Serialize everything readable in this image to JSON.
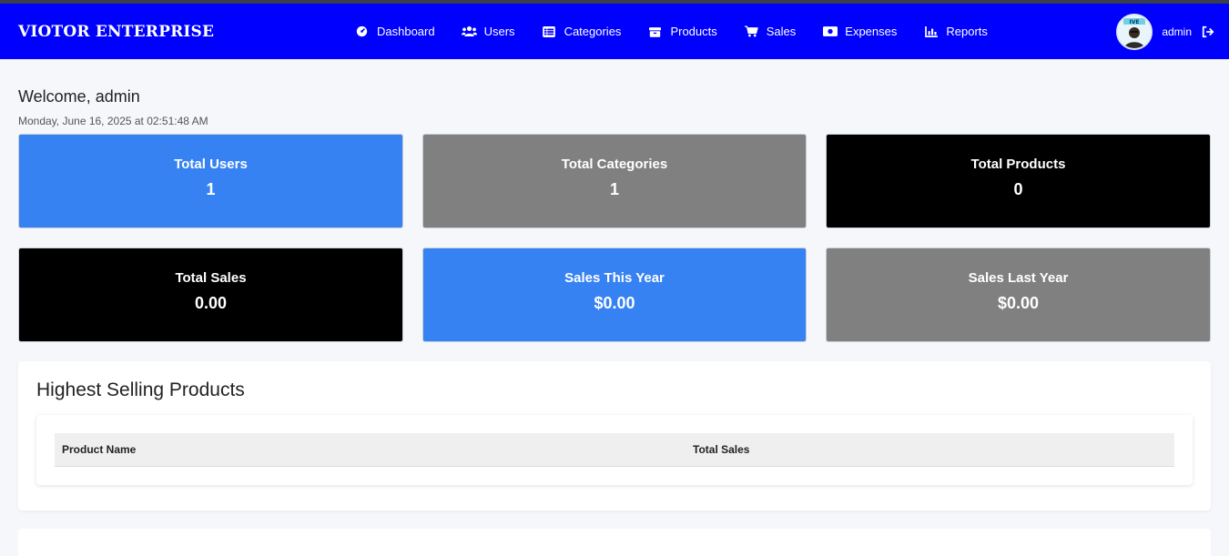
{
  "brand": "VIOTOR ENTERPRISE",
  "nav": [
    {
      "label": "Dashboard",
      "icon": "dashboard-icon"
    },
    {
      "label": "Users",
      "icon": "users-icon"
    },
    {
      "label": "Categories",
      "icon": "categories-icon"
    },
    {
      "label": "Products",
      "icon": "products-icon"
    },
    {
      "label": "Sales",
      "icon": "cart-icon"
    },
    {
      "label": "Expenses",
      "icon": "money-icon"
    },
    {
      "label": "Reports",
      "icon": "chart-icon"
    }
  ],
  "user": {
    "name": "admin",
    "avatar_icon": "avatar",
    "logout_icon": "logout-icon"
  },
  "welcome": "Welcome, admin",
  "datetime": "Monday, June 16, 2025 at 02:51:48 AM",
  "cards": [
    {
      "label": "Total Users",
      "value": "1",
      "color": "#3782f3"
    },
    {
      "label": "Total Categories",
      "value": "1",
      "color": "#808080"
    },
    {
      "label": "Total Products",
      "value": "0",
      "color": "#000000"
    },
    {
      "label": "Total Sales",
      "value": "0.00",
      "color": "#000000"
    },
    {
      "label": "Sales This Year",
      "value": "$0.00",
      "color": "#3782f3"
    },
    {
      "label": "Sales Last Year",
      "value": "$0.00",
      "color": "#808080"
    }
  ],
  "highest": {
    "title": "Highest Selling Products",
    "columns": [
      "Product Name",
      "Total Sales"
    ]
  },
  "colors": {
    "navbar": "#0000ff",
    "page_bg": "#f5f7fa"
  }
}
